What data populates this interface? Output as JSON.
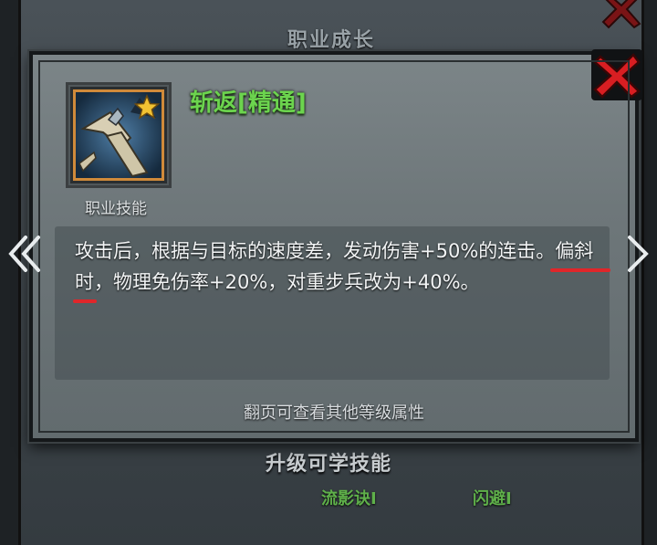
{
  "background_panel": {
    "title": "职业成长"
  },
  "dialog": {
    "skill_name": "斩返[精通]",
    "skill_type": "职业技能",
    "description": "攻击后，根据与目标的速度差，发动伤害+50%的连击。偏斜时，物理免伤率+20%，对重步兵改为+40%。",
    "page_hint": "翻页可查看其他等级属性",
    "close_icon": "close-x-icon",
    "skill_icon": "sword-slash-icon",
    "star_badge": "star-icon"
  },
  "navigation": {
    "prev_icon": "double-chevron-left-icon",
    "next_icon": "chevron-right-icon"
  },
  "lower_section": {
    "title": "升级可学技能",
    "skills": [
      "流影诀I",
      "闪避I"
    ]
  },
  "colors": {
    "skill_name": "#6cd44e",
    "close_red": "#d81e22",
    "icon_border": "#d08a3a",
    "highlight_underline": "#e0262a"
  }
}
